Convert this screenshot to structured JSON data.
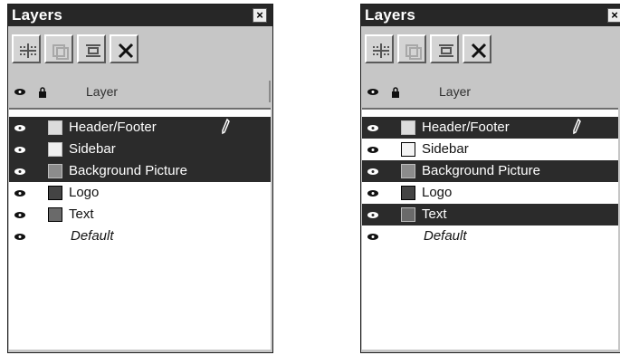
{
  "colors": {
    "titlebar": "#272727",
    "panel_bg": "#c6c6c6",
    "selection": "#2b2b2b",
    "swatch_light": "#dcdcdc",
    "swatch_mid": "#8c8c8c",
    "swatch_dark": "#444444"
  },
  "panels": [
    {
      "title": "Layers",
      "close_glyph": "×",
      "toolbar": [
        {
          "icon": "new-layer-icon"
        },
        {
          "icon": "duplicate-layer-icon"
        },
        {
          "icon": "layer-properties-icon"
        },
        {
          "icon": "delete-layer-icon"
        }
      ],
      "header": {
        "visibility_icon": "eye-icon",
        "lock_icon": "lock-icon",
        "label": "Layer"
      },
      "layers": [
        {
          "name": "Header/Footer",
          "selected": true,
          "visible": true,
          "swatch": "light",
          "editing": true
        },
        {
          "name": "Sidebar",
          "selected": true,
          "visible": true,
          "swatch": "white",
          "editing": false
        },
        {
          "name": "Background Picture",
          "selected": true,
          "visible": true,
          "swatch": "mid",
          "editing": false
        },
        {
          "name": "Logo",
          "selected": false,
          "visible": true,
          "swatch": "dark",
          "editing": false
        },
        {
          "name": "Text",
          "selected": false,
          "visible": true,
          "swatch": "mid",
          "editing": false
        },
        {
          "name": "Default",
          "selected": false,
          "visible": true,
          "swatch": "none",
          "editing": false
        }
      ]
    },
    {
      "title": "Layers",
      "close_glyph": "×",
      "toolbar": [
        {
          "icon": "new-layer-icon"
        },
        {
          "icon": "duplicate-layer-icon"
        },
        {
          "icon": "layer-properties-icon"
        },
        {
          "icon": "delete-layer-icon"
        }
      ],
      "header": {
        "visibility_icon": "eye-icon",
        "lock_icon": "lock-icon",
        "label": "Layer"
      },
      "layers": [
        {
          "name": "Header/Footer",
          "selected": true,
          "visible": true,
          "swatch": "light",
          "editing": true
        },
        {
          "name": "Sidebar",
          "selected": false,
          "visible": true,
          "swatch": "white",
          "editing": false
        },
        {
          "name": "Background Picture",
          "selected": true,
          "visible": true,
          "swatch": "mid",
          "editing": false
        },
        {
          "name": "Logo",
          "selected": false,
          "visible": true,
          "swatch": "dark",
          "editing": false
        },
        {
          "name": "Text",
          "selected": true,
          "visible": true,
          "swatch": "mid",
          "editing": false
        },
        {
          "name": "Default",
          "selected": false,
          "visible": true,
          "swatch": "none",
          "editing": false
        }
      ]
    }
  ]
}
